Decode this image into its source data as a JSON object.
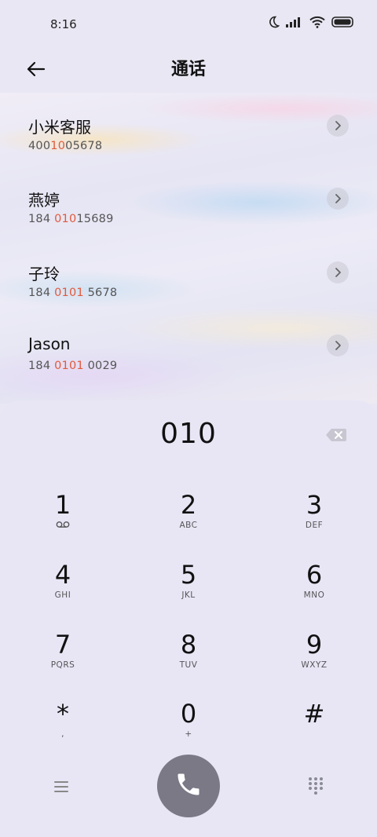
{
  "status": {
    "time": "8:16"
  },
  "header": {
    "title": "通话"
  },
  "contacts": [
    {
      "name": "小米客服",
      "num_pre": "400",
      "num_hl": "10",
      "num_post": "05678"
    },
    {
      "name": "燕婷",
      "num_pre": "184 ",
      "num_hl": "010",
      "num_post": "15689"
    },
    {
      "name": "子玲",
      "num_pre": "184 ",
      "num_hl": "0101",
      "num_post": " 5678"
    },
    {
      "name": "Jason",
      "num_pre": "184 ",
      "num_hl": "0101",
      "num_post": " 0029"
    }
  ],
  "dialer": {
    "input": "010",
    "keys": [
      {
        "digit": "1",
        "sub": ""
      },
      {
        "digit": "2",
        "sub": "ABC"
      },
      {
        "digit": "3",
        "sub": "DEF"
      },
      {
        "digit": "4",
        "sub": "GHI"
      },
      {
        "digit": "5",
        "sub": "JKL"
      },
      {
        "digit": "6",
        "sub": "MNO"
      },
      {
        "digit": "7",
        "sub": "PQRS"
      },
      {
        "digit": "8",
        "sub": "TUV"
      },
      {
        "digit": "9",
        "sub": "WXYZ"
      },
      {
        "digit": "*",
        "sub": ","
      },
      {
        "digit": "0",
        "sub": "+"
      },
      {
        "digit": "#",
        "sub": ""
      }
    ]
  },
  "colors": {
    "highlight": "#e25a3c",
    "call_button": "#7b7986",
    "panel": "#e8e6f5"
  },
  "icons": {
    "back": "arrow-left-icon",
    "voicemail": "voicemail-icon",
    "backspace": "backspace-icon",
    "call": "phone-icon",
    "menu": "menu-icon",
    "keypad": "keypad-icon"
  }
}
